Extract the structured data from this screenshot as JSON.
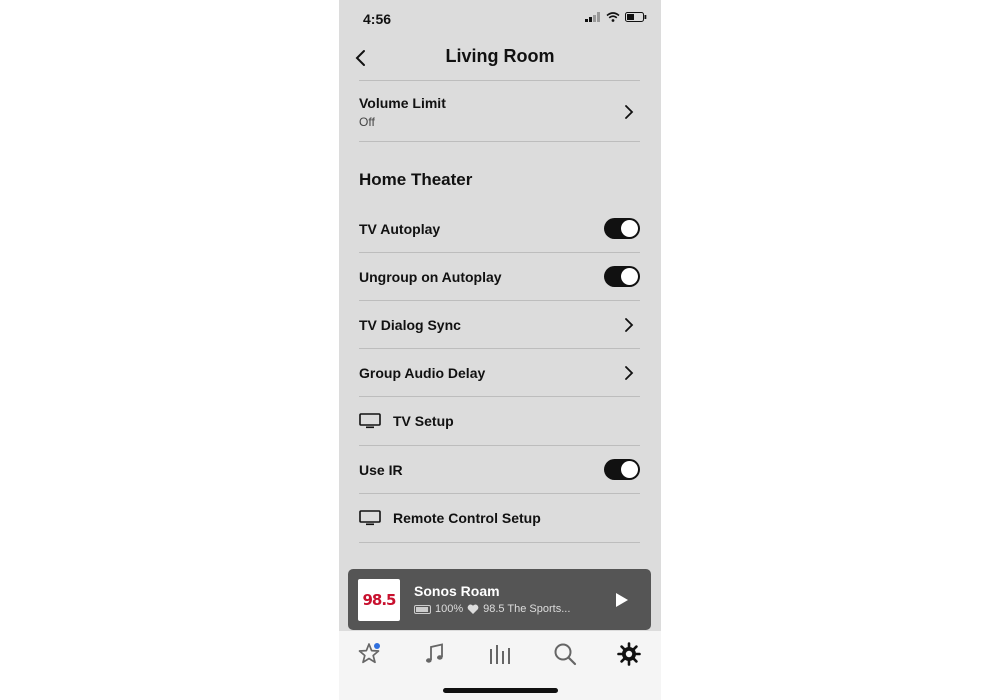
{
  "status": {
    "time": "4:56"
  },
  "nav": {
    "title": "Living Room"
  },
  "volume_limit": {
    "label": "Volume Limit",
    "value": "Off"
  },
  "section": {
    "title": "Home Theater"
  },
  "rows": {
    "tv_autoplay": {
      "label": "TV Autoplay",
      "on": true
    },
    "ungroup_autoplay": {
      "label": "Ungroup on Autoplay",
      "on": true
    },
    "tv_dialog_sync": {
      "label": "TV Dialog Sync"
    },
    "group_audio_delay": {
      "label": "Group Audio Delay"
    },
    "tv_setup": {
      "label": "TV Setup"
    },
    "use_ir": {
      "label": "Use IR",
      "on": true
    },
    "remote_setup": {
      "label": "Remote Control Setup"
    }
  },
  "now_playing": {
    "title": "Sonos Roam",
    "battery": "100%",
    "station": "98.5 The Sports...",
    "logo_text": "98.5"
  },
  "tabs": [
    "star-icon",
    "music-note-icon",
    "rooms-icon",
    "search-icon",
    "gear-icon"
  ],
  "colors": {
    "background": "#dcdcdc",
    "toggle_on": "#111111",
    "now_playing_bg": "#555555",
    "badge": "#2f6fde"
  }
}
